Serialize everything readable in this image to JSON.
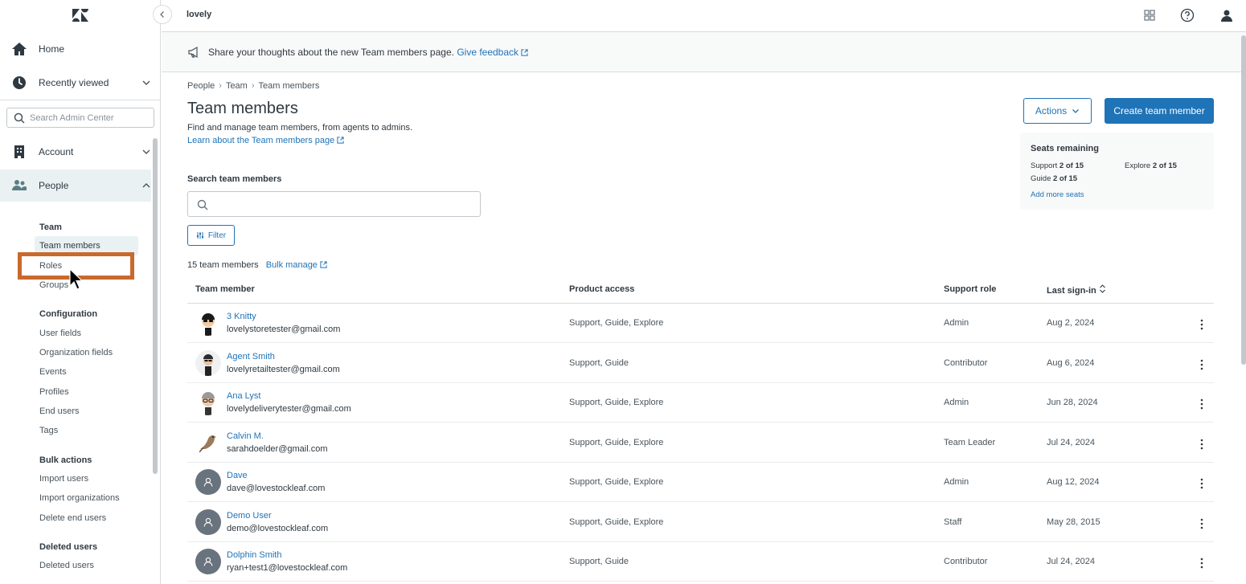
{
  "header": {
    "brand": "lovely"
  },
  "banner": {
    "text": "Share your thoughts about the new Team members page.",
    "link": "Give feedback"
  },
  "sidebar": {
    "home": "Home",
    "recently_viewed": "Recently viewed",
    "search_placeholder": "Search Admin Center",
    "account": "Account",
    "people": "People",
    "team_head": "Team",
    "team_members": "Team members",
    "roles": "Roles",
    "groups": "Groups",
    "configuration_head": "Configuration",
    "user_fields": "User fields",
    "organization_fields": "Organization fields",
    "events": "Events",
    "profiles": "Profiles",
    "end_users": "End users",
    "tags": "Tags",
    "bulk_actions_head": "Bulk actions",
    "import_users": "Import users",
    "import_organizations": "Import organizations",
    "delete_end_users": "Delete end users",
    "deleted_users_head": "Deleted users",
    "deleted_users": "Deleted users"
  },
  "breadcrumb": [
    "People",
    "Team",
    "Team members"
  ],
  "page": {
    "title": "Team members",
    "description": "Find and manage team members, from agents to admins.",
    "learn_link": "Learn about the Team members page",
    "actions_label": "Actions",
    "create_label": "Create team member"
  },
  "seats": {
    "title": "Seats remaining",
    "support_label": "Support",
    "support_value": "2 of 15",
    "explore_label": "Explore",
    "explore_value": "2 of 15",
    "guide_label": "Guide",
    "guide_value": "2 of 15",
    "add_link": "Add more seats"
  },
  "search": {
    "label": "Search team members",
    "value": ""
  },
  "filter_label": "Filter",
  "list": {
    "count": "15 team members",
    "bulk_manage": "Bulk manage"
  },
  "table": {
    "headers": {
      "member": "Team member",
      "access": "Product access",
      "role": "Support role",
      "signin": "Last sign-in"
    },
    "rows": [
      {
        "name": "3 Knitty",
        "email": "lovelystoretester@gmail.com",
        "access": "Support, Guide, Explore",
        "role": "Admin",
        "signin": "Aug 2, 2024",
        "avatar": "figure-sunglasses"
      },
      {
        "name": "Agent Smith",
        "email": "lovelyretailtester@gmail.com",
        "access": "Support, Guide",
        "role": "Contributor",
        "signin": "Aug 6, 2024",
        "avatar": "figure-suit"
      },
      {
        "name": "Ana Lyst",
        "email": "lovelydeliverytester@gmail.com",
        "access": "Support, Guide, Explore",
        "role": "Admin",
        "signin": "Jun 28, 2024",
        "avatar": "figure-glasses"
      },
      {
        "name": "Calvin M.",
        "email": "sarahdoelder@gmail.com",
        "access": "Support, Guide, Explore",
        "role": "Team Leader",
        "signin": "Jul 24, 2024",
        "avatar": "bird"
      },
      {
        "name": "Dave",
        "email": "dave@lovestockleaf.com",
        "access": "Support, Guide, Explore",
        "role": "Admin",
        "signin": "Aug 12, 2024",
        "avatar": "default-user"
      },
      {
        "name": "Demo User",
        "email": "demo@lovestockleaf.com",
        "access": "Support, Guide, Explore",
        "role": "Staff",
        "signin": "May 28, 2015",
        "avatar": "default-user"
      },
      {
        "name": "Dolphin Smith",
        "email": "ryan+test1@lovestockleaf.com",
        "access": "Support, Guide",
        "role": "Contributor",
        "signin": "Jul 24, 2024",
        "avatar": "default-user"
      }
    ]
  },
  "colors": {
    "accent": "#1f73b7",
    "highlight": "#c86a2d",
    "nav_active": "#e9f1f3"
  }
}
